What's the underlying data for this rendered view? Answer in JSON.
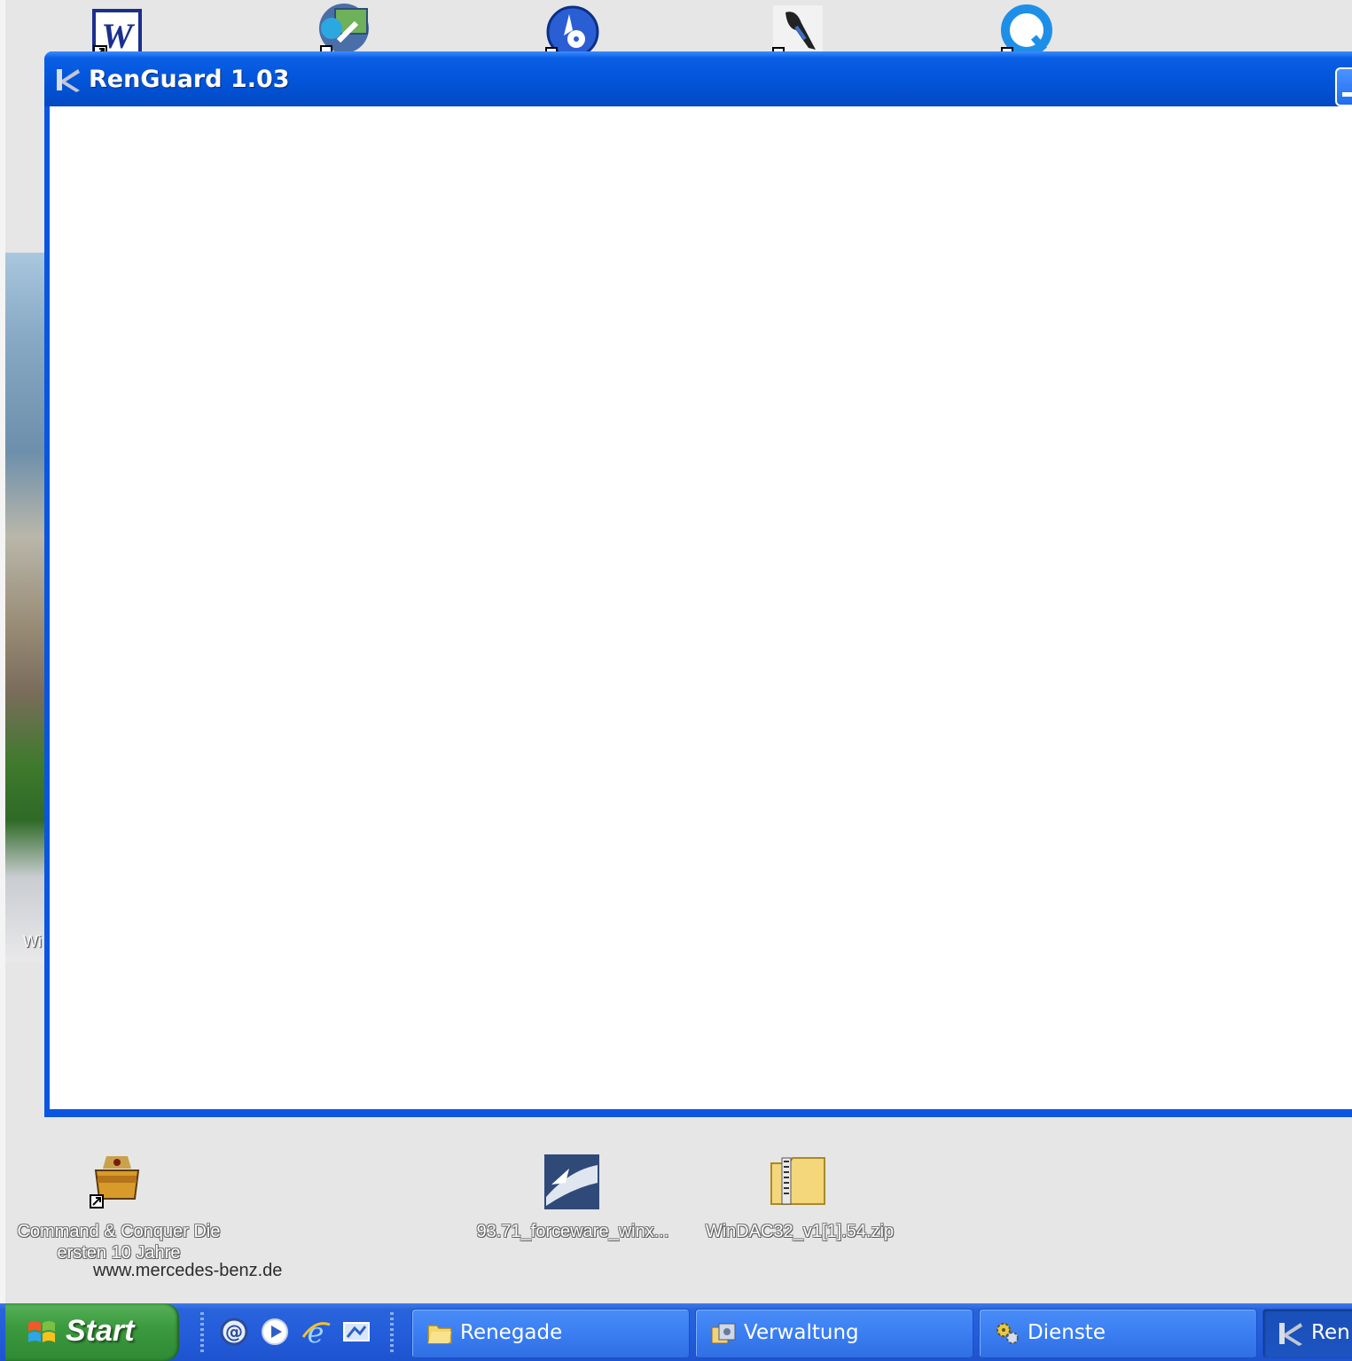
{
  "window": {
    "title": "RenGuard 1.03"
  },
  "desktop": {
    "wallpaper_caption": "Wi",
    "wallpaper_url_text": "www.mercedes-benz.de",
    "icons": [
      {
        "name": "word-icon",
        "label": ""
      },
      {
        "name": "photo-app-icon",
        "label": ""
      },
      {
        "name": "media-disc-icon",
        "label": ""
      },
      {
        "name": "bird-app-icon",
        "label": ""
      },
      {
        "name": "quicktime-icon",
        "label": ""
      },
      {
        "name": "cnc-icon",
        "label": "Command & Conquer Die ersten 10 Jahre"
      },
      {
        "name": "forceware-icon",
        "label": "93.71_forceware_winx..."
      },
      {
        "name": "zip-folder-icon",
        "label": "WinDAC32_v1[1].54.zip"
      }
    ]
  },
  "taskbar": {
    "start_label": "Start",
    "buttons": [
      {
        "label": "Renegade",
        "icon": "folder-icon"
      },
      {
        "label": "Verwaltung",
        "icon": "admin-tools-icon"
      },
      {
        "label": "Dienste",
        "icon": "gears-icon"
      },
      {
        "label": "Ren",
        "icon": "renguard-icon",
        "active": true
      }
    ]
  },
  "colors": {
    "titlebar": "#0254d8",
    "taskbar": "#245ddb",
    "start": "#3c9a3f",
    "desktop": "#e6e6e6"
  }
}
